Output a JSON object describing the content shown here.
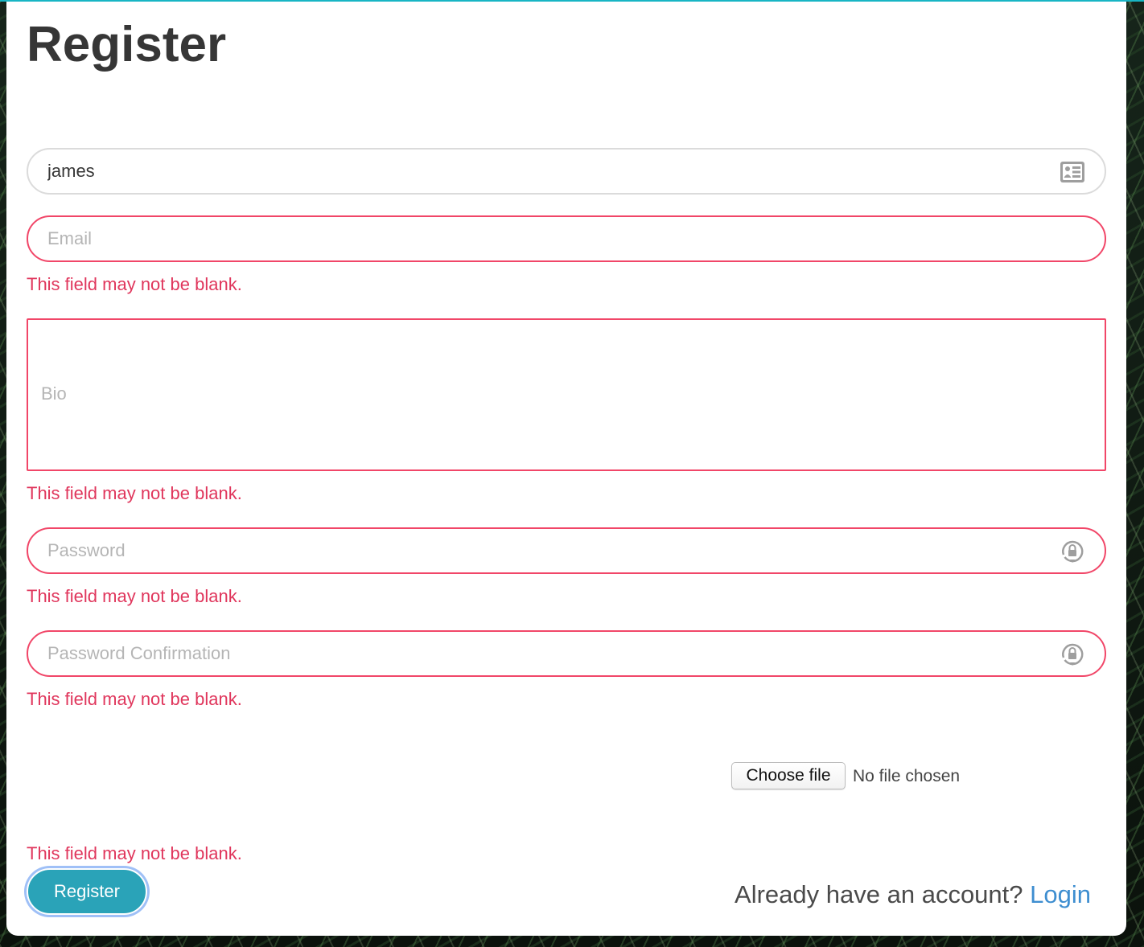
{
  "page": {
    "title": "Register"
  },
  "form": {
    "username": {
      "value": "james",
      "icon": "id-card-icon"
    },
    "email": {
      "placeholder": "Email",
      "error": "This field may not be blank."
    },
    "bio": {
      "placeholder": "Bio",
      "error": "This field may not be blank."
    },
    "password": {
      "placeholder": "Password",
      "icon": "lock-refresh-icon",
      "error": "This field may not be blank."
    },
    "password_confirmation": {
      "placeholder": "Password Confirmation",
      "icon": "lock-refresh-icon",
      "error": "This field may not be blank."
    },
    "image": {
      "button_label": "Choose file",
      "status": "No file chosen",
      "error": "This field may not be blank."
    },
    "submit_label": "Register"
  },
  "footer": {
    "prompt": "Already have an account?",
    "link_label": "Login"
  },
  "colors": {
    "accent": "#2aa3b8",
    "error": "#f14668",
    "link": "#3e8ed0",
    "top_bar": "#18b5c4"
  }
}
